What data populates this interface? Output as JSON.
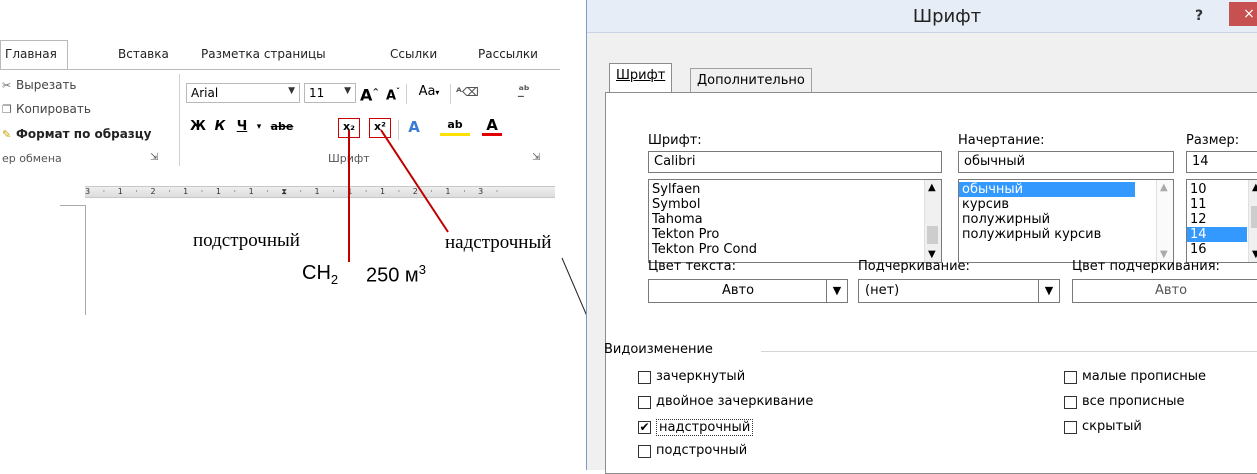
{
  "ribbon": {
    "tabs": [
      "Главная",
      "Вставка",
      "Разметка страницы",
      "Ссылки",
      "Рассылки"
    ],
    "clipboard": {
      "cut": "Вырезать",
      "copy": "Копировать",
      "format_painter": "Формат по образцу",
      "group_label": "ер обмена"
    },
    "font": {
      "name": "Arial",
      "size": "11",
      "grow": "A",
      "shrink": "A",
      "change_case": "Aa",
      "bold": "Ж",
      "italic": "К",
      "underline": "Ч",
      "strike": "abe",
      "subscript": "x₂",
      "superscript": "x²",
      "text_effects": "A",
      "highlight": "ab",
      "font_color": "A",
      "group_label": "Шрифт"
    },
    "ruler": "3 · 1 · 2 · 1 · 1 · 1 · ⧗ · 1 · 1 · 1 · 2 · 1 · 3 ·"
  },
  "annotations": {
    "subscript_label": "подстрочный",
    "superscript_label": "надстрочный",
    "example_ch": "CH",
    "example_ch_sub": "2",
    "example_m": "250 м",
    "example_m_sup": "3"
  },
  "dialog": {
    "title": "Шрифт",
    "help": "?",
    "close": "×",
    "tabs": [
      "Шрифт",
      "Дополнительно"
    ],
    "font_label": "Шрифт:",
    "font_value": "Calibri",
    "font_list": [
      "Sylfaen",
      "Symbol",
      "Tahoma",
      "Tekton Pro",
      "Tekton Pro Cond"
    ],
    "style_label": "Начертание:",
    "style_value": "обычный",
    "style_list": [
      "обычный",
      "курсив",
      "полужирный",
      "полужирный курсив"
    ],
    "size_label": "Размер:",
    "size_value": "14",
    "size_list": [
      "10",
      "11",
      "12",
      "14",
      "16"
    ],
    "color_label": "Цвет текста:",
    "color_value": "Авто",
    "underline_label": "Подчеркивание:",
    "underline_value": "(нет)",
    "underline_color_label": "Цвет подчеркивания:",
    "underline_color_value": "Авто",
    "effects_label": "Видоизменение",
    "effects": {
      "strike": "зачеркнутый",
      "double_strike": "двойное зачеркивание",
      "superscript": "надстрочный",
      "subscript": "подстрочный",
      "small_caps": "малые прописные",
      "all_caps": "все прописные",
      "hidden": "скрытый"
    },
    "checked": {
      "superscript": true
    }
  },
  "colors": {
    "accent_red": "#c00000",
    "selection": "#3399ff"
  }
}
